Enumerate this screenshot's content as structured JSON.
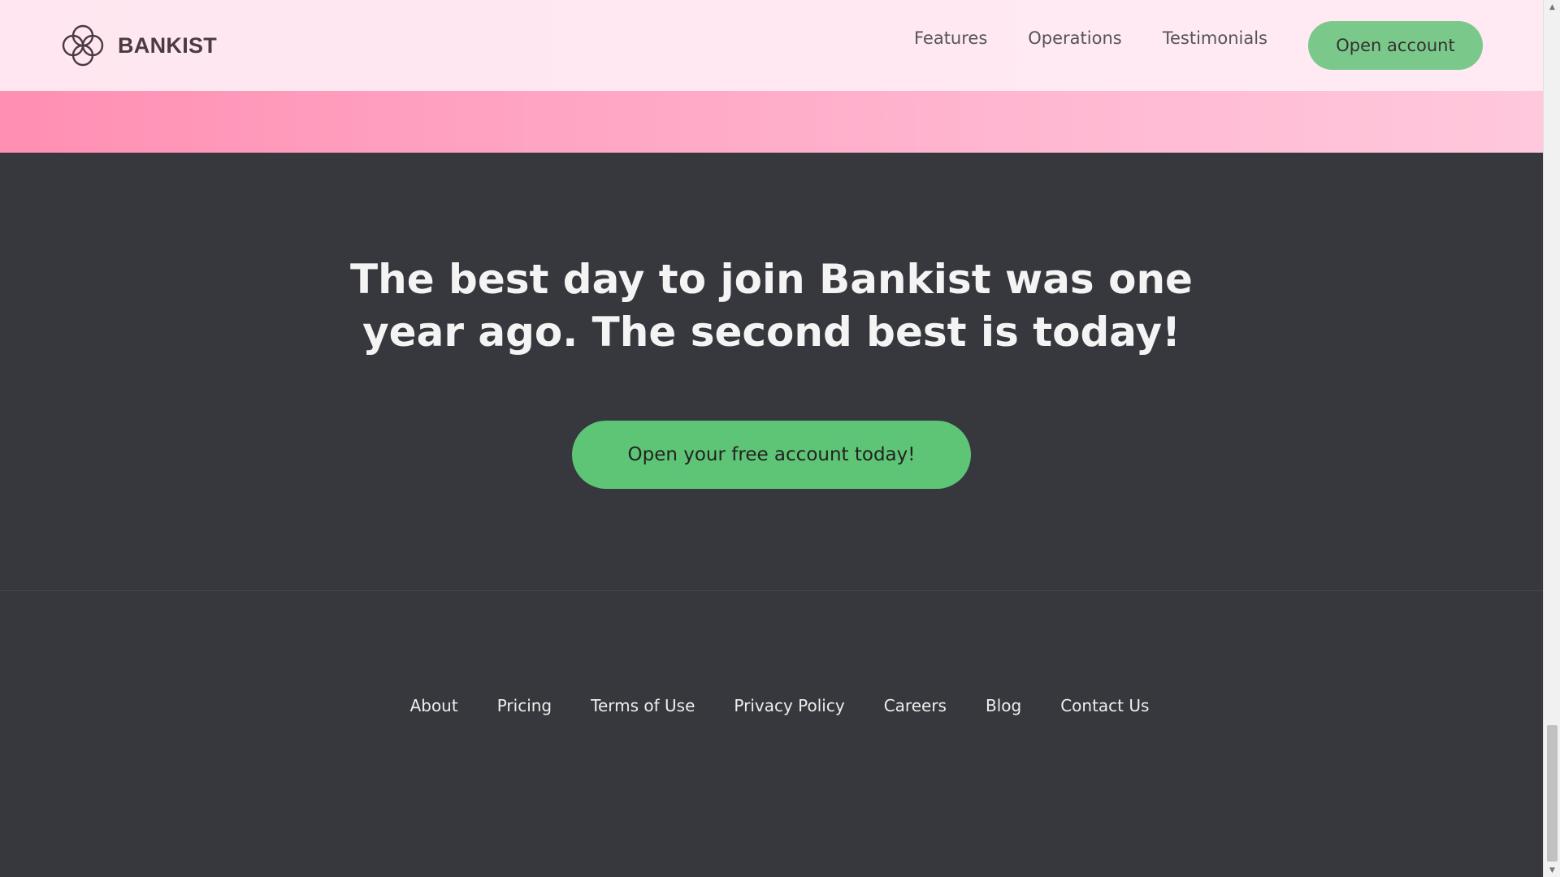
{
  "header": {
    "logo_text": "BANKIST",
    "nav": [
      "Features",
      "Operations",
      "Testimonials"
    ],
    "cta_label": "Open account"
  },
  "signup": {
    "title_line1": "The best day to join Bankist was one",
    "title_line2": "year ago. The second best is today!",
    "button_label": "Open your free account today!"
  },
  "footer": {
    "links": [
      "About",
      "Pricing",
      "Terms of Use",
      "Privacy Policy",
      "Careers",
      "Blog",
      "Contact Us"
    ]
  },
  "colors": {
    "accent_green": "#5ec576",
    "dark_bg": "#37383d",
    "pink": "#ffa7c5"
  }
}
